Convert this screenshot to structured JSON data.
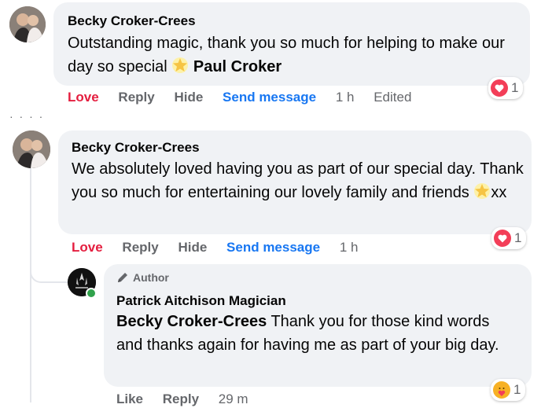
{
  "comment1": {
    "author": "Becky Croker-Crees",
    "text_before_emoji": "Outstanding magic, thank you so much for helping to make our day so special",
    "emoji": "star-glow-emoji",
    "mention": "Paul Croker",
    "actions": {
      "love": "Love",
      "reply": "Reply",
      "hide": "Hide",
      "send": "Send message",
      "time": "1 h",
      "edited": "Edited"
    },
    "reaction_count": "1"
  },
  "comment2": {
    "author": "Becky Croker-Crees",
    "text_before_emoji": "We absolutely loved having you as part of our special day. Thank you so much for entertaining our lovely family and friends",
    "emoji": "star-glow-emoji",
    "text_after_emoji": "xx",
    "actions": {
      "love": "Love",
      "reply": "Reply",
      "hide": "Hide",
      "send": "Send message",
      "time": "1 h"
    },
    "reaction_count": "1"
  },
  "reply": {
    "badge": "Author",
    "author": "Patrick Aitchison Magician",
    "mention": "Becky Croker-Crees",
    "text": "Thank you for those kind words and thanks again for having me as part of your big day.",
    "actions": {
      "like": "Like",
      "reply": "Reply",
      "time": "29 m"
    },
    "reaction_count": "1"
  },
  "colors": {
    "love": "#e41e3f",
    "link": "#1877f2",
    "muted": "#65676b",
    "bubble": "#f0f2f5"
  }
}
